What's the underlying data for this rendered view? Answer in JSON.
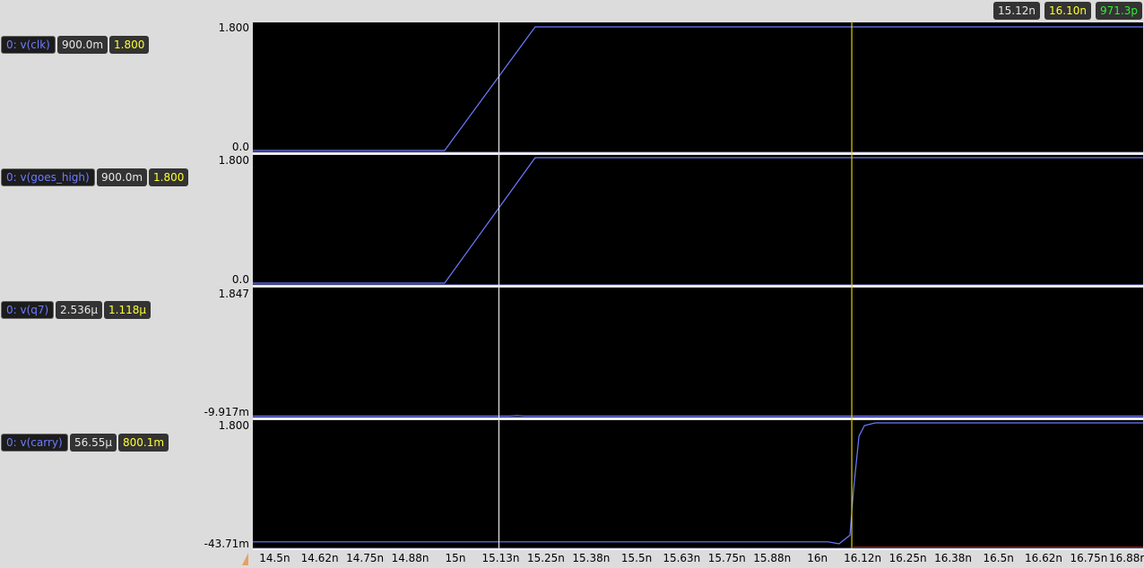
{
  "cursor_readout": {
    "cursor1": "15.12n",
    "cursor2": "16.10n",
    "delta": "971.3p"
  },
  "colors": {
    "background": "#dcdcdc",
    "plot_bg": "#000000",
    "trace": "#6d7bff",
    "cursor1": "#e6e6e6",
    "cursor2": "#e0d000",
    "readout_yellow": "#ffff33",
    "readout_green": "#33ee33"
  },
  "chart_data": {
    "type": "line",
    "x_unit": "s",
    "x_range_ns": [
      14.44,
      16.9
    ],
    "x_ticks": [
      {
        "v": 14.5,
        "label": "14.5n"
      },
      {
        "v": 14.625,
        "label": "14.62n"
      },
      {
        "v": 14.75,
        "label": "14.75n"
      },
      {
        "v": 14.875,
        "label": "14.88n"
      },
      {
        "v": 15.0,
        "label": "15n"
      },
      {
        "v": 15.125,
        "label": "15.13n"
      },
      {
        "v": 15.25,
        "label": "15.25n"
      },
      {
        "v": 15.375,
        "label": "15.38n"
      },
      {
        "v": 15.5,
        "label": "15.5n"
      },
      {
        "v": 15.625,
        "label": "15.63n"
      },
      {
        "v": 15.75,
        "label": "15.75n"
      },
      {
        "v": 15.875,
        "label": "15.88n"
      },
      {
        "v": 16.0,
        "label": "16n"
      },
      {
        "v": 16.125,
        "label": "16.12n"
      },
      {
        "v": 16.25,
        "label": "16.25n"
      },
      {
        "v": 16.375,
        "label": "16.38n"
      },
      {
        "v": 16.5,
        "label": "16.5n"
      },
      {
        "v": 16.625,
        "label": "16.62n"
      },
      {
        "v": 16.75,
        "label": "16.75n"
      },
      {
        "v": 16.875,
        "label": "16.88r"
      }
    ],
    "cursor1_ns": 15.12,
    "cursor2_ns": 16.095,
    "series": [
      {
        "name": "0: v(clk)",
        "value_at_cursor1": "900.0m",
        "value_at_cursor2": "1.800",
        "ymin": 0.0,
        "ymax": 1.8,
        "ymin_label": "0.0",
        "ymax_label": "1.800",
        "points": [
          [
            14.44,
            0.0
          ],
          [
            14.97,
            0.0
          ],
          [
            15.22,
            1.8
          ],
          [
            16.9,
            1.8
          ]
        ]
      },
      {
        "name": "0: v(goes_high)",
        "value_at_cursor1": "900.0m",
        "value_at_cursor2": "1.800",
        "ymin": 0.0,
        "ymax": 1.8,
        "ymin_label": "0.0",
        "ymax_label": "1.800",
        "points": [
          [
            14.44,
            0.0
          ],
          [
            14.97,
            0.0
          ],
          [
            15.22,
            1.8
          ],
          [
            16.9,
            1.8
          ]
        ]
      },
      {
        "name": "0: v(q7)",
        "value_at_cursor1": "2.536µ",
        "value_at_cursor2": "1.118µ",
        "ymin": -0.009917,
        "ymax": 1.847,
        "ymin_label": "-9.917m",
        "ymax_label": "1.847",
        "points": [
          [
            14.44,
            0.0
          ],
          [
            15.15,
            0.0
          ],
          [
            15.17,
            0.006
          ],
          [
            15.19,
            0.0
          ],
          [
            16.9,
            0.0
          ]
        ]
      },
      {
        "name": "0: v(carry)",
        "value_at_cursor1": "56.55µ",
        "value_at_cursor2": "800.1m",
        "ymin": -0.04371,
        "ymax": 1.8,
        "ymin_label": "-43.71m",
        "ymax_label": "1.800",
        "points": [
          [
            14.44,
            0.0
          ],
          [
            16.03,
            0.0
          ],
          [
            16.06,
            -0.03
          ],
          [
            16.09,
            0.1
          ],
          [
            16.1,
            0.8
          ],
          [
            16.115,
            1.6
          ],
          [
            16.13,
            1.76
          ],
          [
            16.16,
            1.8
          ],
          [
            16.9,
            1.8
          ]
        ]
      }
    ]
  }
}
